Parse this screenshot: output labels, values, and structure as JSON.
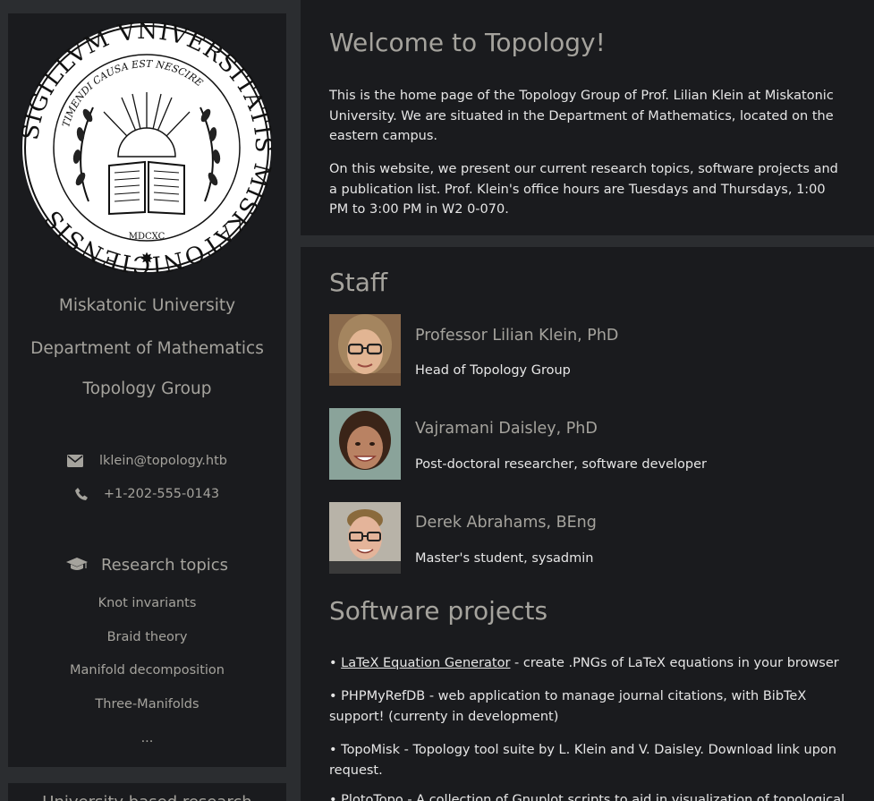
{
  "sidebar": {
    "seal": {
      "outer_text": "SIGILLVM VNIVERSITATIS MISKATONICIENSIS",
      "inner_text": "TIMENDI CAUSA EST NESCIRE",
      "year": "MDCXC"
    },
    "university": "Miskatonic University",
    "department": "Department of Mathematics",
    "group": "Topology Group",
    "email": "lklein@topology.htb",
    "phone": "+1-202-555-0143",
    "research_heading": "Research topics",
    "topics": [
      "Knot invariants",
      "Braid theory",
      "Manifold decomposition",
      "Three-Manifolds",
      "..."
    ],
    "next_panel_heading": "University based research"
  },
  "welcome": {
    "title": "Welcome to Topology!",
    "para1": "This is the home page of the Topology Group of Prof. Lilian Klein at Miskatonic University. We are situated in the Department of Mathematics, located on the eastern campus.",
    "para2": "On this website, we present our current research topics, software projects and a publication list. Prof. Klein's office hours are Tuesdays and Thursdays, 1:00 PM to 3:00 PM in W2 0-070."
  },
  "staff": {
    "title": "Staff",
    "members": [
      {
        "name": "Professor Lilian Klein, PhD",
        "role": "Head of Topology Group"
      },
      {
        "name": "Vajramani Daisley, PhD",
        "role": "Post-doctoral researcher, software developer"
      },
      {
        "name": "Derek Abrahams, BEng",
        "role": "Master's student, sysadmin"
      }
    ]
  },
  "projects": {
    "title": "Software projects",
    "items": [
      {
        "bullet": "• ",
        "link": "LaTeX Equation Generator",
        "text": " - create .PNGs of LaTeX equations in your browser"
      },
      {
        "bullet": "• ",
        "link": "",
        "text": "PHPMyRefDB - web application to manage journal citations, with BibTeX support! (currenty in development)"
      },
      {
        "bullet": "• ",
        "link": "",
        "text": "TopoMisk - Topology tool suite by L. Klein and V. Daisley. Download link upon request."
      },
      {
        "bullet": "• ",
        "link": "",
        "text": "PlotoTopo - A collection of Gnuplot scripts to aid in visualization of topological"
      }
    ]
  },
  "colors": {
    "page_bg": "#2b2d30",
    "panel_bg": "#1a1b1e",
    "muted_text": "#a5a39d",
    "body_text": "#e6e6e6"
  }
}
